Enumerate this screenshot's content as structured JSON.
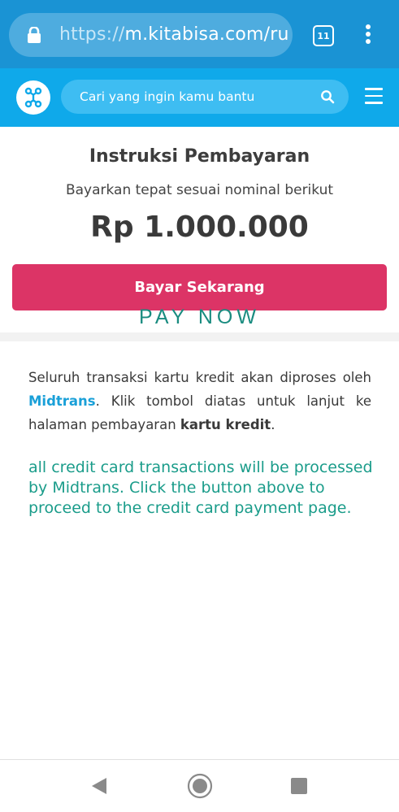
{
  "browser": {
    "url_scheme": "https://",
    "url_host": "m.kitabisa.com/ru",
    "tab_count": "11",
    "theme_color": "#1a93d4"
  },
  "header": {
    "logo_icon": "kitabisa-logo-icon",
    "search_placeholder": "Cari yang ingin kamu bantu",
    "brand_color": "#0fa9ea"
  },
  "payment": {
    "title": "Instruksi Pembayaran",
    "instruction": "Bayarkan tepat sesuai nominal berikut",
    "amount": "Rp 1.000.000",
    "pay_button_label": "Bayar Sekarang",
    "pay_button_color": "#dc3466",
    "pay_now_label": "PAY NOW"
  },
  "info": {
    "text_part1": "Seluruh transaksi kartu kredit akan diproses oleh ",
    "brand": "Midtrans",
    "text_part2": ". Klik tombol diatas untuk lanjut ke halaman pembayaran ",
    "bold_term": "kartu kredit",
    "text_part3": ".",
    "translation": "all credit card transactions will be processed by Midtrans. Click the button above to proceed to the credit card payment page."
  },
  "navbar": {
    "back_icon": "back-triangle-icon",
    "home_icon": "home-circle-icon",
    "recent_icon": "recent-apps-square-icon"
  }
}
